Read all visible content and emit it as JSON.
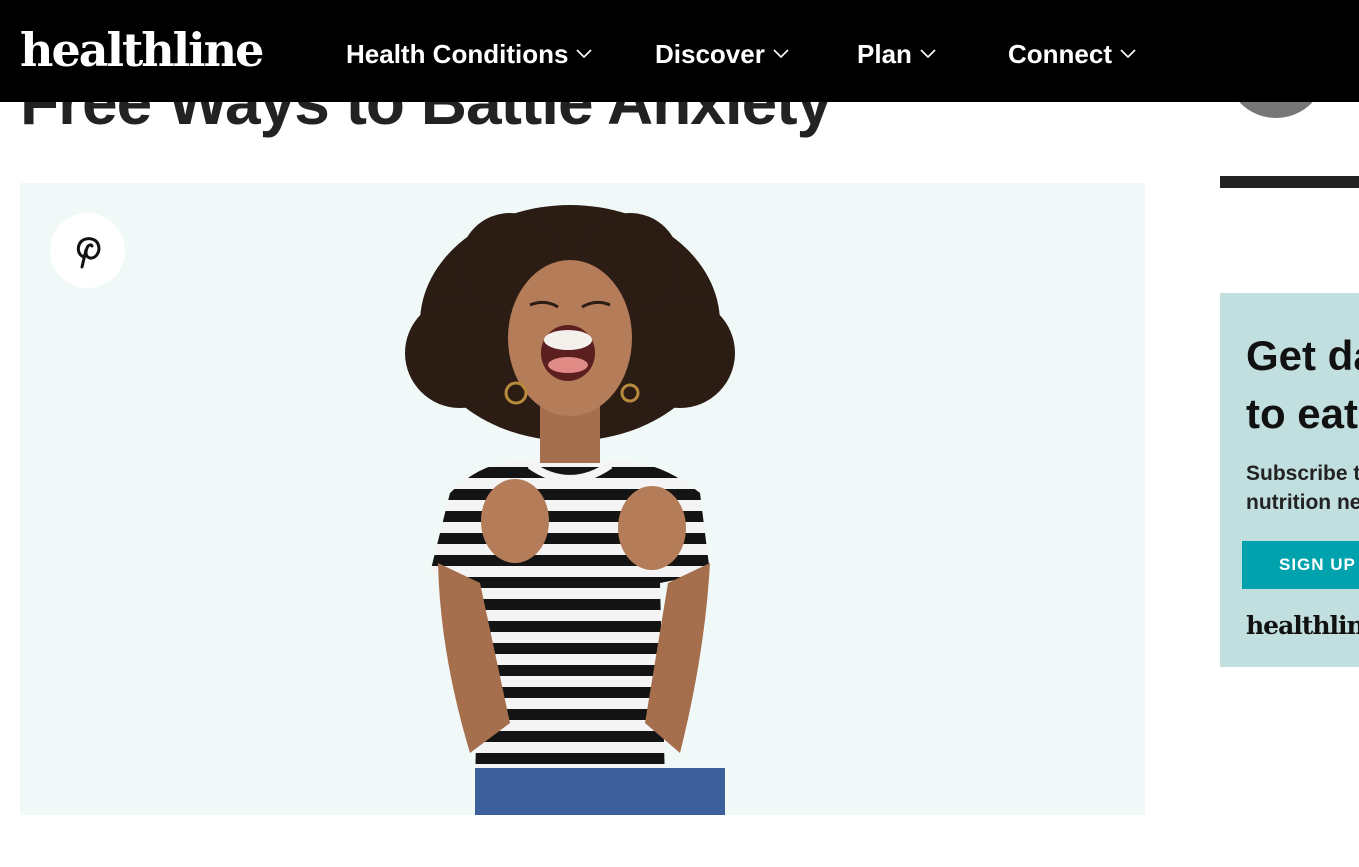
{
  "nav": {
    "logo": "healthline",
    "items": [
      {
        "label": "Health Conditions"
      },
      {
        "label": "Discover"
      },
      {
        "label": "Plan"
      },
      {
        "label": "Connect"
      }
    ]
  },
  "article": {
    "title": "Free Ways to Battle Anxiety"
  },
  "icons": {
    "pin": "pinterest-icon",
    "chevron": "chevron-down-icon"
  },
  "ad": {
    "headline": "Get da\nto eat",
    "subtext": "Subscribe t\nnutrition ne",
    "button": "SIGN UP",
    "logo": "healthline"
  },
  "colors": {
    "nav_bg": "#000000",
    "hero_bg": "#f1f9f8",
    "ad_bg": "#c2dfe0",
    "ad_button": "#00a3ad"
  }
}
